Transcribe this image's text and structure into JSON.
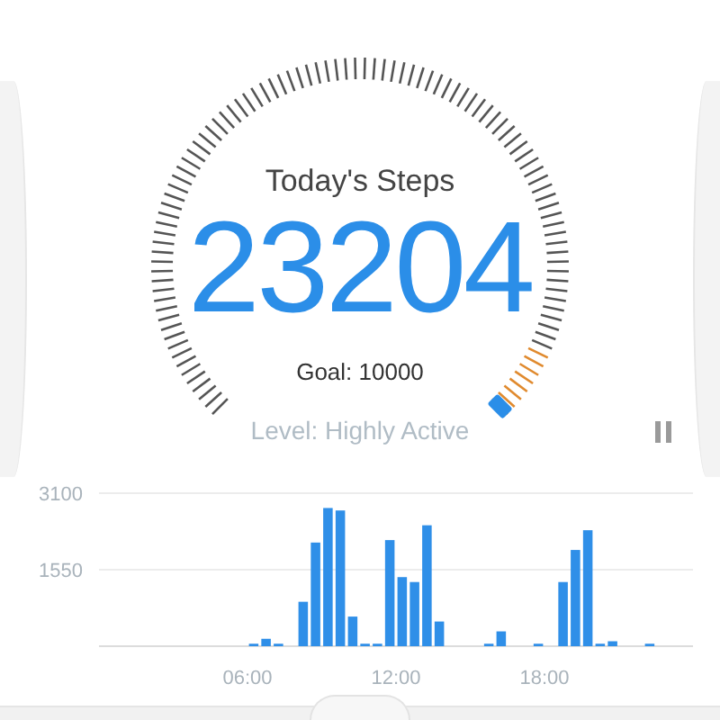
{
  "gauge": {
    "title": "Today's Steps",
    "steps": "23204",
    "goal": "Goal: 10000",
    "activity_level": "Level: Highly Active"
  },
  "chart": {
    "chart_data": {
      "type": "bar",
      "ylim": [
        0,
        3100
      ],
      "yticks": [
        1550,
        3100
      ],
      "x": [
        0.25,
        0.75,
        1.25,
        1.75,
        2.25,
        2.75,
        3.25,
        3.75,
        4.25,
        4.75,
        5.25,
        5.75,
        6.25,
        6.75,
        7.25,
        7.75,
        8.25,
        8.75,
        9.25,
        9.75,
        10.25,
        10.75,
        11.25,
        11.75,
        12.25,
        12.75,
        13.25,
        13.75,
        14.25,
        14.75,
        15.25,
        15.75,
        16.25,
        16.75,
        17.25,
        17.75,
        18.25,
        18.75,
        19.25,
        19.75,
        20.25,
        20.75,
        21.25,
        21.75,
        22.25,
        22.75,
        23.25,
        23.75
      ],
      "xlim": [
        0,
        24
      ],
      "xticks": [
        {
          "value": 6,
          "label": "06:00"
        },
        {
          "value": 12,
          "label": "12:00"
        },
        {
          "value": 18,
          "label": "18:00"
        }
      ],
      "series": [
        {
          "color": "#2f8fe8",
          "values": [
            0,
            0,
            0,
            0,
            0,
            0,
            0,
            0,
            0,
            0,
            0,
            0,
            50,
            150,
            50,
            0,
            900,
            2100,
            2800,
            2750,
            600,
            50,
            50,
            2150,
            1400,
            1300,
            2450,
            500,
            0,
            0,
            0,
            50,
            300,
            0,
            0,
            50,
            0,
            1300,
            1950,
            2350,
            50,
            100,
            0,
            0,
            50,
            0,
            0,
            0
          ]
        }
      ]
    }
  }
}
